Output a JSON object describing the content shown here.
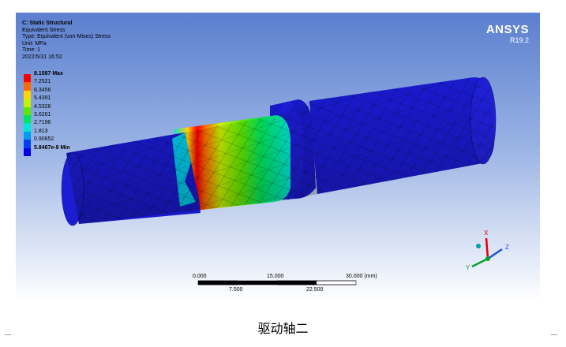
{
  "info": {
    "analysis": "C: Static Structural",
    "result": "Equivalent Stress",
    "type": "Type: Equivalent (von-Mises) Stress",
    "unit": "Unit: MPa",
    "time": "Time: 1",
    "date": "2022/5/31 16:52"
  },
  "brand": {
    "name": "ANSYS",
    "version": "R19.2"
  },
  "legend": {
    "entries": [
      {
        "label": "8.1587 Max",
        "color": "#ff0000",
        "bold": true
      },
      {
        "label": "7.2521",
        "color": "#ff6a00",
        "bold": false
      },
      {
        "label": "6.3456",
        "color": "#ffd400",
        "bold": false
      },
      {
        "label": "5.4391",
        "color": "#c8f000",
        "bold": false
      },
      {
        "label": "4.5326",
        "color": "#5ee800",
        "bold": false
      },
      {
        "label": "3.6261",
        "color": "#00e65c",
        "bold": false
      },
      {
        "label": "2.7196",
        "color": "#00e6d6",
        "bold": false
      },
      {
        "label": "1.813",
        "color": "#009cf0",
        "bold": false
      },
      {
        "label": "0.90652",
        "color": "#0040f0",
        "bold": false
      },
      {
        "label": "5.8467e-8 Min",
        "color": "#0000e6",
        "bold": true
      }
    ]
  },
  "scale": {
    "top_labels": [
      "0.000",
      "15.000",
      "30.000 (mm)"
    ],
    "bottom_labels": [
      "7.500",
      "22.500"
    ]
  },
  "triad": {
    "x": "X",
    "y": "Y",
    "z": "Z"
  },
  "caption": "驱动轴二",
  "colors": {
    "shaft_blue": "#1a1ad0",
    "accent_red": "#e00000"
  }
}
